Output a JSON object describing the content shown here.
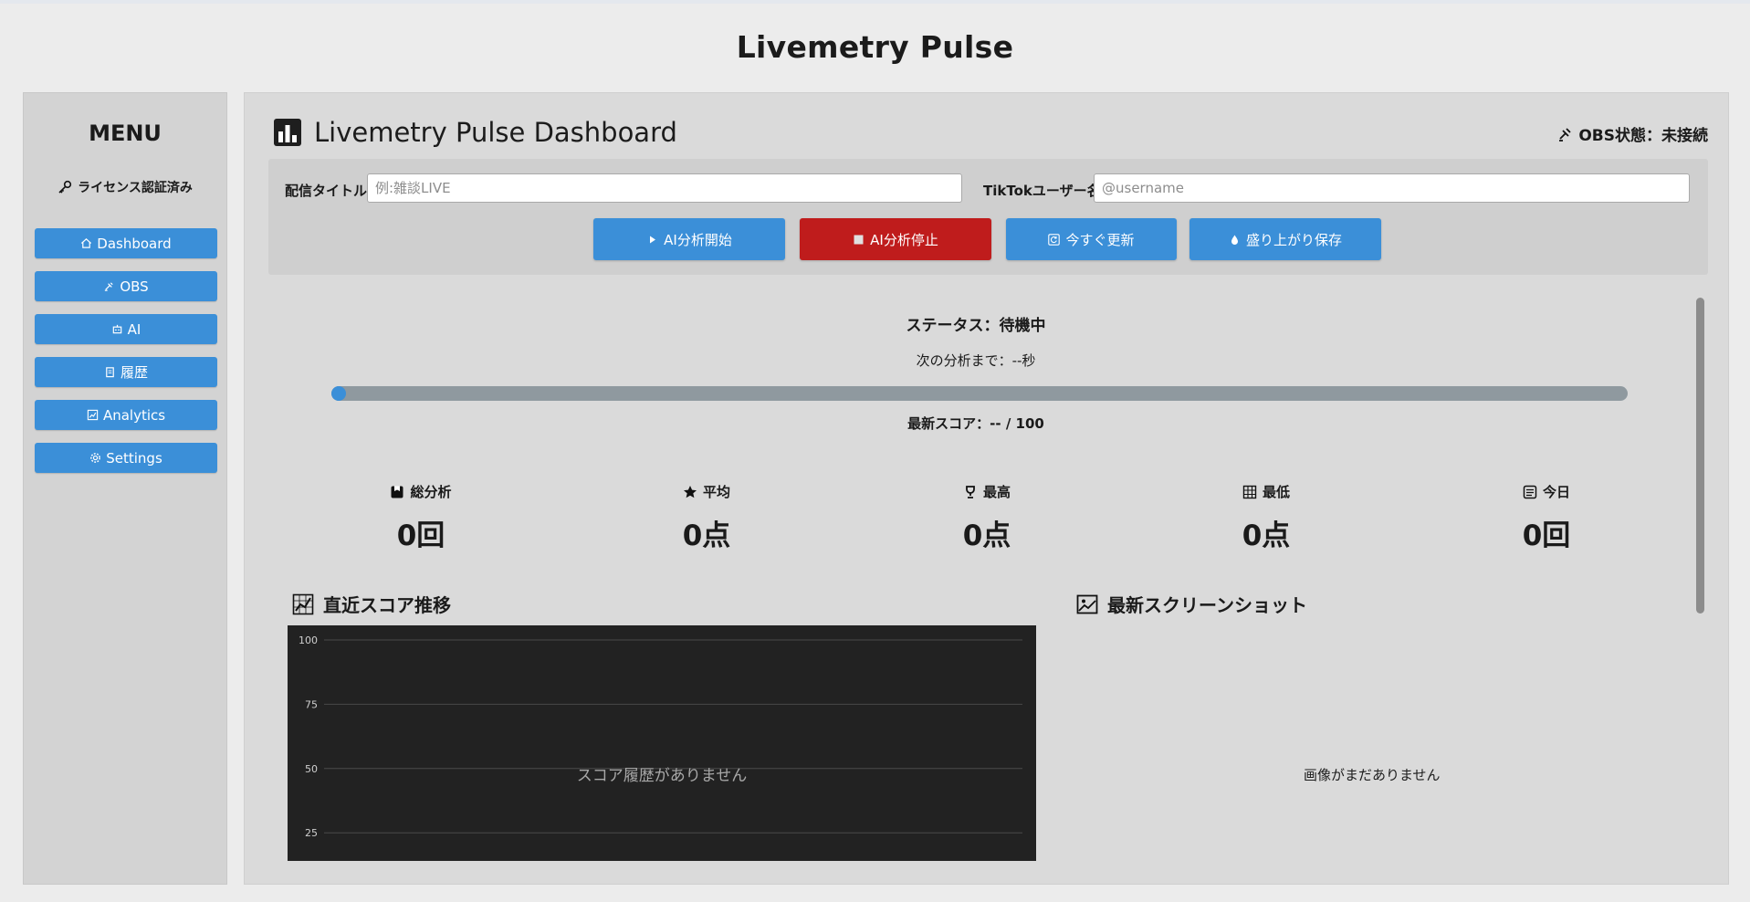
{
  "app": {
    "title": "Livemetry Pulse"
  },
  "sidebar": {
    "menu_title": "MENU",
    "license": "ライセンス認証済み",
    "items": [
      {
        "label": "Dashboard",
        "icon": "home-icon"
      },
      {
        "label": "OBS",
        "icon": "satellite-icon"
      },
      {
        "label": "AI",
        "icon": "robot-icon"
      },
      {
        "label": "履歴",
        "icon": "document-icon"
      },
      {
        "label": "Analytics",
        "icon": "chart-icon"
      },
      {
        "label": "Settings",
        "icon": "gear-icon"
      }
    ]
  },
  "main": {
    "title": "Livemetry Pulse Dashboard",
    "obs_status": "OBS状態：未接続",
    "stream_title_label": "配信タイトル",
    "stream_title_placeholder": "例:雑談LIVE",
    "tiktok_label": "TikTokユーザー名",
    "tiktok_placeholder": "@username",
    "buttons": {
      "start": "AI分析開始",
      "stop": "AI分析停止",
      "refresh": "今すぐ更新",
      "save": "盛り上がり保存"
    },
    "status": "ステータス：待機中",
    "next_analysis": "次の分析まで：--秒",
    "progress": 0,
    "latest_score": "最新スコア：-- / 100",
    "stats": [
      {
        "label": "総分析",
        "value": "0回",
        "icon": "box-icon"
      },
      {
        "label": "平均",
        "value": "0点",
        "icon": "star-icon"
      },
      {
        "label": "最高",
        "value": "0点",
        "icon": "trophy-icon"
      },
      {
        "label": "最低",
        "value": "0点",
        "icon": "grid-icon"
      },
      {
        "label": "今日",
        "value": "0回",
        "icon": "calendar-icon"
      }
    ],
    "score_section_title": "直近スコア推移",
    "screenshot_section_title": "最新スクリーンショット",
    "screenshot_empty": "画像がまだありません"
  },
  "chart_data": {
    "type": "line",
    "title": "",
    "y_ticks": [
      "100",
      "75",
      "50",
      "25"
    ],
    "ylim": [
      0,
      100
    ],
    "series": [],
    "empty_message": "スコア履歴がありません"
  }
}
